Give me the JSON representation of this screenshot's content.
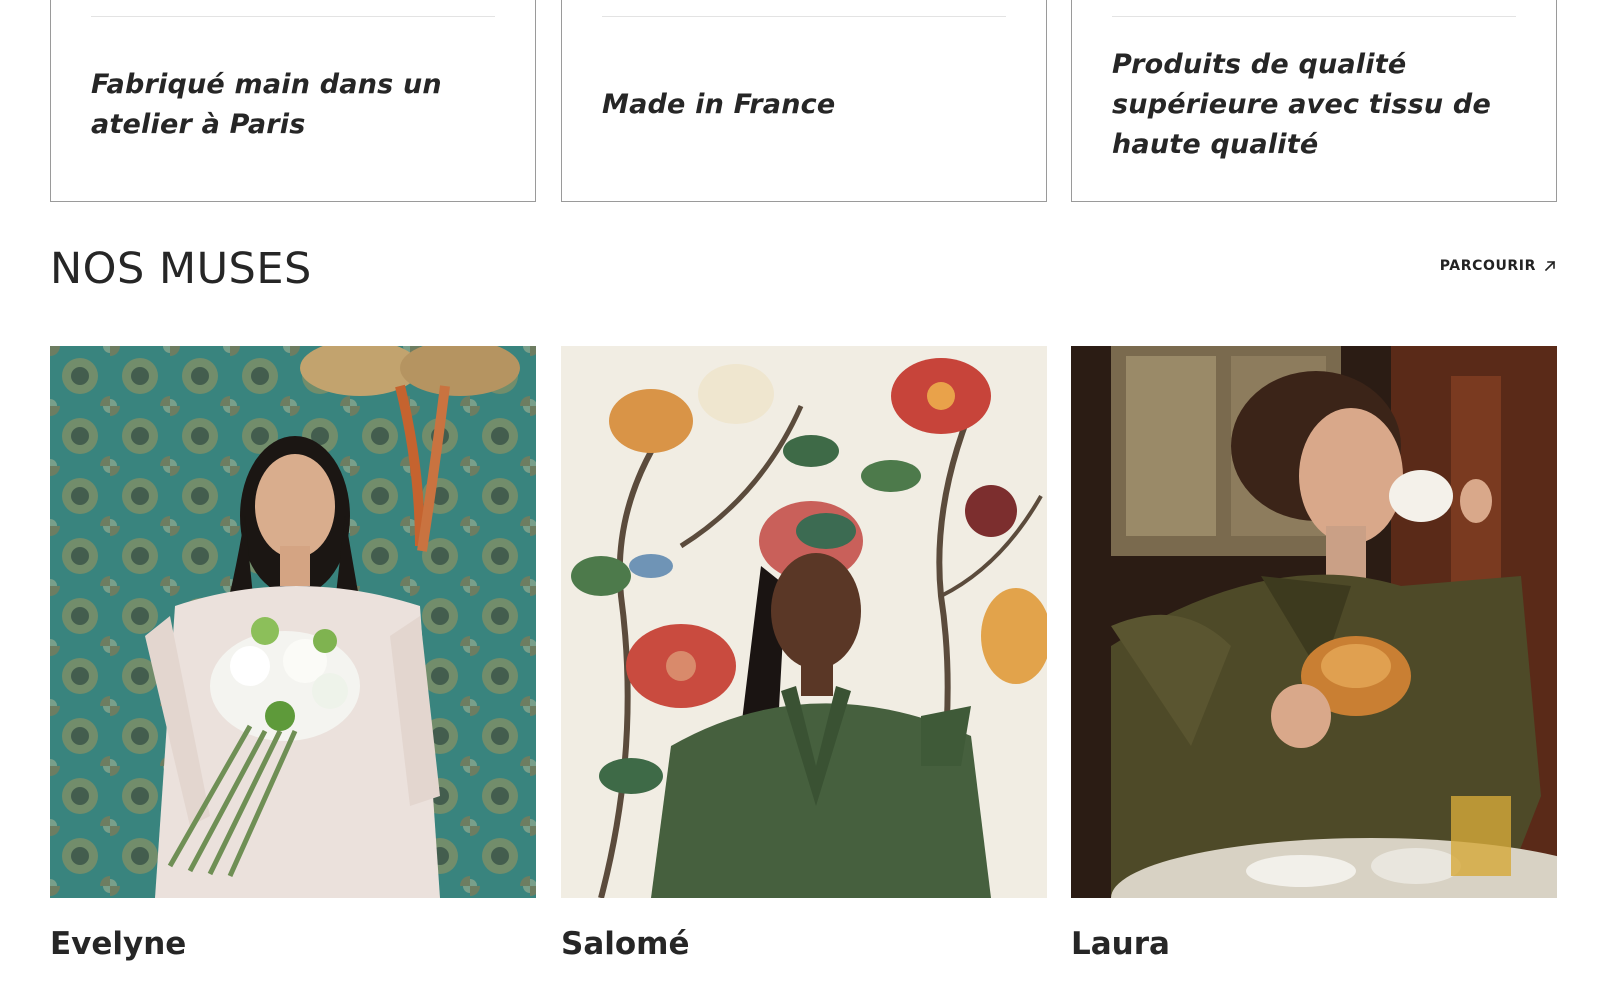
{
  "features": [
    {
      "text": "Fabriqué main dans un atelier à Paris"
    },
    {
      "text": "Made in France"
    },
    {
      "text": "Produits de qualité supérieure avec tissu de haute qualité"
    }
  ],
  "muses_section": {
    "title": "NOS MUSES",
    "browse_label": "PARCOURIR",
    "browse_icon": "arrow-up-right-icon"
  },
  "muses": [
    {
      "name": "Evelyne",
      "photo": "muse-photo-evelyne"
    },
    {
      "name": "Salomé",
      "photo": "muse-photo-salome"
    },
    {
      "name": "Laura",
      "photo": "muse-photo-laura"
    }
  ]
}
